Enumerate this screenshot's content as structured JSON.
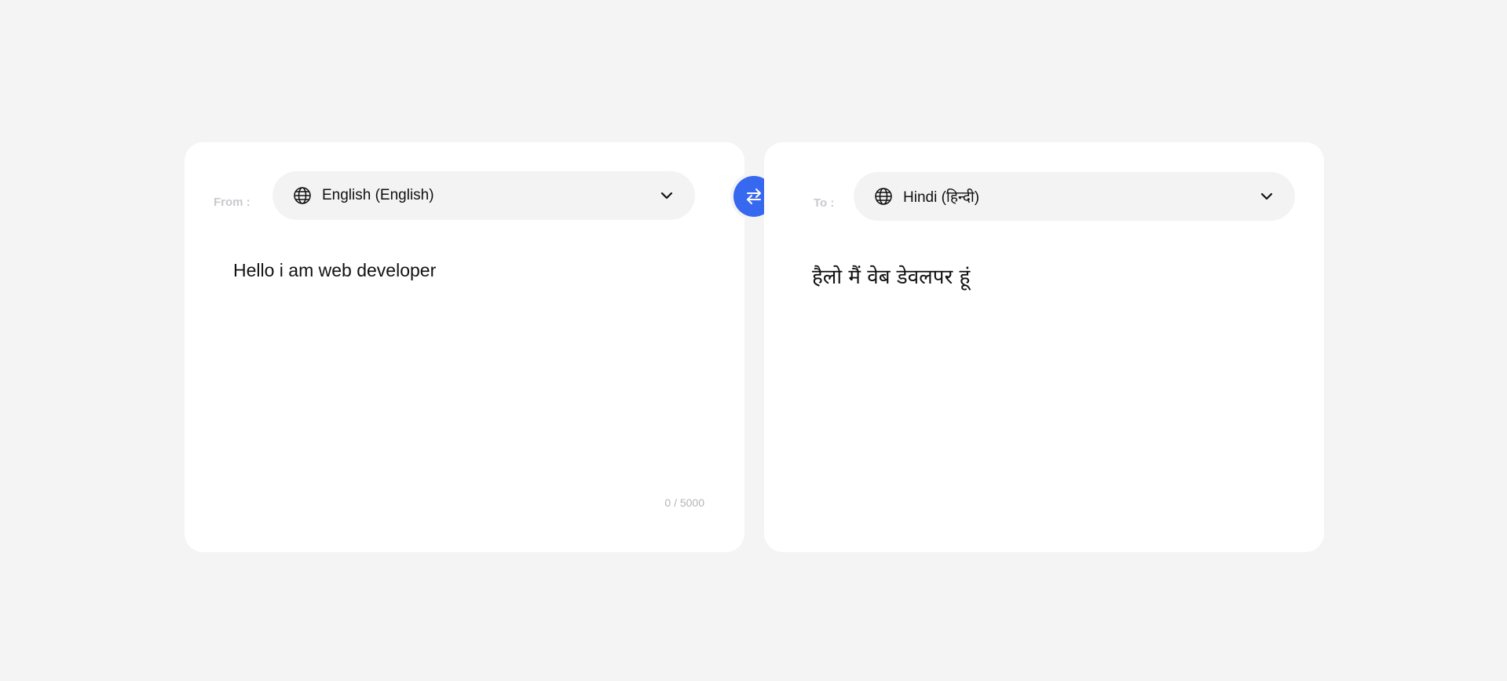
{
  "source": {
    "label": "From :",
    "language": "English (English)",
    "text": "Hello i am web developer",
    "char_count": "0 / 5000"
  },
  "target": {
    "label": "To :",
    "language": "Hindi (हिन्दी)",
    "text": "हैलो मैं वेब डेवलपर हूं"
  },
  "icons": {
    "globe": "globe-icon",
    "chevron": "chevron-down-icon",
    "swap": "swap-arrows-icon"
  },
  "colors": {
    "accent": "#3768f0",
    "background": "#f4f4f4",
    "card": "#ffffff",
    "select_bg": "#f3f3f3",
    "label": "#c9c9cf",
    "muted": "#b5b5b5"
  }
}
